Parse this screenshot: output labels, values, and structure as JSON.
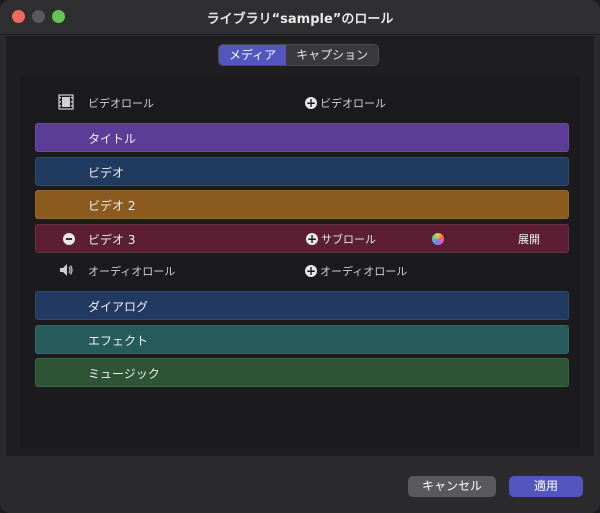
{
  "window": {
    "title": "ライブラリ“sample”のロール"
  },
  "tabs": [
    {
      "label": "メディア",
      "active": true
    },
    {
      "label": "キャプション",
      "active": false
    }
  ],
  "video_section": {
    "label": "ビデオロール",
    "add_label": "ビデオロール",
    "icon": "film-icon",
    "roles": [
      {
        "label": "タイトル",
        "color": "#5b3d98"
      },
      {
        "label": "ビデオ",
        "color": "#203a60"
      },
      {
        "label": "ビデオ 2",
        "color": "#8a5a1f"
      },
      {
        "label": "ビデオ 3",
        "color": "#5b1e33"
      }
    ],
    "selected_role": {
      "subrole_label": "サブロール",
      "expand_label": "展開"
    }
  },
  "audio_section": {
    "label": "オーディオロール",
    "add_label": "オーディオロール",
    "icon": "speaker-icon",
    "roles": [
      {
        "label": "ダイアログ",
        "color": "#223a61"
      },
      {
        "label": "エフェクト",
        "color": "#255c5b"
      },
      {
        "label": "ミュージック",
        "color": "#2d5434"
      }
    ]
  },
  "footer": {
    "cancel_label": "キャンセル",
    "apply_label": "適用"
  },
  "colors": {
    "accent": "#5456bf"
  }
}
